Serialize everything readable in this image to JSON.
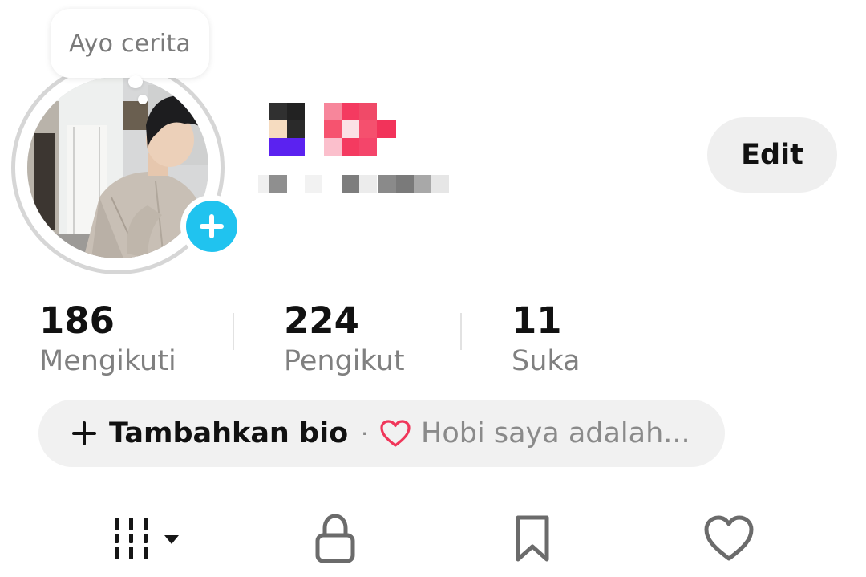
{
  "note": {
    "text": "Ayo cerita"
  },
  "profile": {
    "edit_label": "Edit"
  },
  "stats": [
    {
      "value": "186",
      "label": "Mengikuti"
    },
    {
      "value": "224",
      "label": "Pengikut"
    },
    {
      "value": "11",
      "label": "Suka"
    }
  ],
  "bio": {
    "add_label": "Tambahkan bio",
    "separator": "·",
    "hint": "Hobi saya adalah..."
  },
  "tabs": [
    {
      "icon": "grid-icon"
    },
    {
      "icon": "lock-icon"
    },
    {
      "icon": "bookmark-icon"
    },
    {
      "icon": "heart-icon"
    }
  ],
  "colors": {
    "accent_story": "#20c3ef",
    "heart_outline": "#f0365a",
    "pill_bg": "#f1f1f1",
    "secondary_text": "#808080"
  }
}
